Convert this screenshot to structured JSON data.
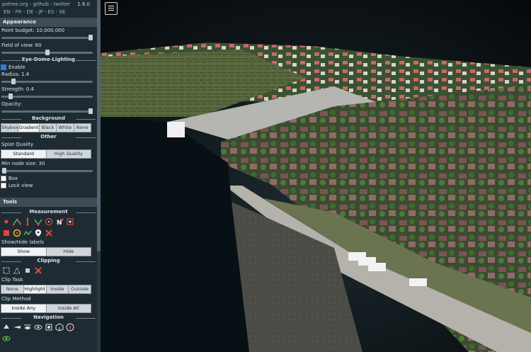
{
  "header": {
    "links": "potree.org - github - twitter",
    "version": "1.8.0",
    "languages": "EN - FR - DE - JP - ES - SE"
  },
  "appearance": {
    "title": "Appearance",
    "point_budget_label": "Point budget: 10,000,000",
    "point_budget_fraction": 0.98,
    "fov_label": "Field of view: 60",
    "fov_fraction": 0.5,
    "edl": {
      "title": "Eye-Dome-Lighting",
      "enable_label": "Enable",
      "enabled": true,
      "radius_label": "Radius: 1.4",
      "radius_fraction": 0.13,
      "strength_label": "Strength: 0.4",
      "strength_fraction": 0.1,
      "opacity_label": "Opacity:",
      "opacity_fraction": 0.98
    },
    "background": {
      "title": "Background",
      "options": [
        "Skybox",
        "Gradient",
        "Black",
        "White",
        "None"
      ],
      "selected": "Gradient"
    },
    "other": {
      "title": "Other",
      "splat_label": "Splat Quality",
      "splat_options": [
        "Standard",
        "High Quality"
      ],
      "splat_selected": "Standard",
      "min_node_label": "Min node size: 30",
      "min_node_fraction": 0.03,
      "box_label": "Box",
      "lock_label": "Lock view"
    }
  },
  "tools": {
    "title": "Tools",
    "measurement_title": "Measurement",
    "show_hide_label": "Show/Hide labels",
    "show_label": "Show",
    "hide_label": "Hide",
    "clipping_title": "Clipping",
    "clip_task_label": "Clip Task",
    "clip_task_options": [
      "None",
      "Highlight",
      "Inside",
      "Outside"
    ],
    "clip_task_selected": "Highlight",
    "clip_method_label": "Clip Method",
    "clip_method_options": [
      "Inside Any",
      "Inside All"
    ],
    "clip_method_selected": "Inside Any",
    "navigation_title": "Navigation"
  },
  "colors": {
    "sidebar": "#1f2b33",
    "section": "#3d4c56",
    "accent": "#2a7de1",
    "icon_red": "#e0463a",
    "icon_green": "#69d34f"
  }
}
